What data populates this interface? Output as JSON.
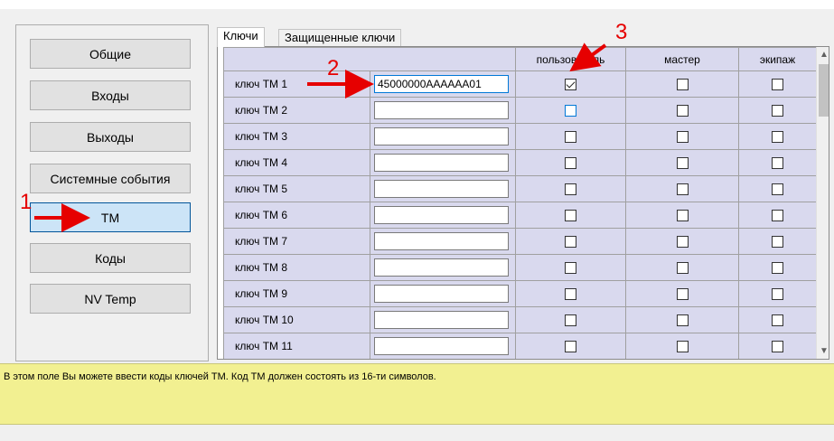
{
  "nav": {
    "items": [
      {
        "label": "Общие"
      },
      {
        "label": "Входы"
      },
      {
        "label": "Выходы"
      },
      {
        "label": "Системные события"
      },
      {
        "label": "ТМ",
        "active": true
      },
      {
        "label": "Коды"
      },
      {
        "label": "NV Temp"
      }
    ]
  },
  "tabs": [
    {
      "label": "Ключи",
      "active": true
    },
    {
      "label": "Защищенные ключи"
    }
  ],
  "grid": {
    "columns": [
      "",
      "",
      "пользователь",
      "мастер",
      "экипаж"
    ],
    "rows": [
      {
        "label": "ключ ТМ 1",
        "value": "45000000AAAAAA01",
        "user": true,
        "master": false,
        "crew": false
      },
      {
        "label": "ключ ТМ 2",
        "value": "",
        "user": false,
        "master": false,
        "crew": false
      },
      {
        "label": "ключ ТМ 3",
        "value": "",
        "user": false,
        "master": false,
        "crew": false
      },
      {
        "label": "ключ ТМ 4",
        "value": "",
        "user": false,
        "master": false,
        "crew": false
      },
      {
        "label": "ключ ТМ 5",
        "value": "",
        "user": false,
        "master": false,
        "crew": false
      },
      {
        "label": "ключ ТМ 6",
        "value": "",
        "user": false,
        "master": false,
        "crew": false
      },
      {
        "label": "ключ ТМ 7",
        "value": "",
        "user": false,
        "master": false,
        "crew": false
      },
      {
        "label": "ключ ТМ 8",
        "value": "",
        "user": false,
        "master": false,
        "crew": false
      },
      {
        "label": "ключ ТМ 9",
        "value": "",
        "user": false,
        "master": false,
        "crew": false
      },
      {
        "label": "ключ ТМ 10",
        "value": "",
        "user": false,
        "master": false,
        "crew": false
      },
      {
        "label": "ключ ТМ 11",
        "value": "",
        "user": false,
        "master": false,
        "crew": false
      }
    ]
  },
  "hint": {
    "text": "В этом поле Вы можете ввести коды ключей ТМ. Код ТМ должен состоять из 16-ти символов."
  },
  "annotations": {
    "label1": "1",
    "label2": "2",
    "label3": "3",
    "color": "#e60000"
  },
  "icons": {
    "scroll_up": "chevron-up-icon",
    "scroll_down": "chevron-down-icon",
    "check": "checkmark-icon",
    "arrow": "red-arrow-icon"
  },
  "colors": {
    "grid_cell": "#d9d9ee",
    "active_nav": "#cce4f7",
    "hint_bg": "#f2f091",
    "annotation": "#e60000"
  }
}
